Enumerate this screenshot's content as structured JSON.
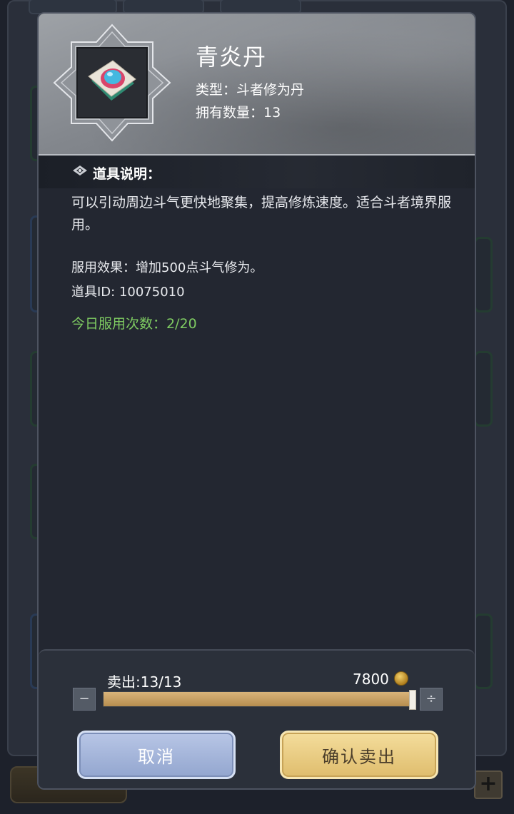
{
  "item": {
    "name": "青炎丹",
    "type_line": "类型：斗者修为丹",
    "count_line": "拥有数量：13",
    "icon": "pill-icon"
  },
  "description": {
    "section_label": "道具说明：",
    "text": "可以引动周边斗气更快地聚集，提高修炼速度。适合斗者境界服用。",
    "effect_line": "服用效果：增加500点斗气修为。",
    "id_line": "道具ID: 10075010",
    "daily_line": "今日服用次数：2/20"
  },
  "sell": {
    "label": "卖出:13/13",
    "price": "7800",
    "fill_fraction": 1.0,
    "minus_label": "−",
    "plus_label": "÷",
    "cancel_label": "取消",
    "confirm_label": "确认卖出"
  },
  "colors": {
    "highlight_green": "#7fcc62",
    "slider_gold": "#c9a263",
    "cancel_blue": "#a7b7dc",
    "confirm_gold": "#ebcc83"
  }
}
